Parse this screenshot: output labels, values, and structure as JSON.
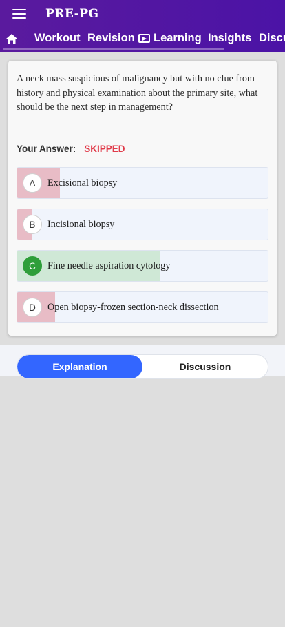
{
  "app": {
    "title": "PRE-PG"
  },
  "nav": {
    "tabs": [
      {
        "label": "Workout"
      },
      {
        "label": "Revision"
      },
      {
        "label": "Learning",
        "icon": "play-box-icon"
      },
      {
        "label": "Insights"
      },
      {
        "label": "Discu"
      }
    ]
  },
  "question": {
    "text": "A neck mass suspicious of malignancy but with no clue from history and physical examination about the primary site, what should be the next step in management?",
    "answer_label": "Your Answer:",
    "answer_value": "SKIPPED"
  },
  "options": [
    {
      "letter": "A",
      "text": "Excisional biopsy",
      "percent": 17
    },
    {
      "letter": "B",
      "text": "Incisional biopsy",
      "percent": 6
    },
    {
      "letter": "C",
      "text": "Fine needle aspiration cytology",
      "percent": 57,
      "correct": true
    },
    {
      "letter": "D",
      "text": "Open biopsy-frozen section-neck dissection",
      "percent": 15
    }
  ],
  "colors": {
    "header": "#5a1a9e",
    "wrong_fill": "#e8bcc6",
    "correct_fill": "#cfe8d6",
    "skipped": "#e03b4a",
    "accent": "#3366ff"
  },
  "segments": {
    "explanation": "Explanation",
    "discussion": "Discussion"
  }
}
